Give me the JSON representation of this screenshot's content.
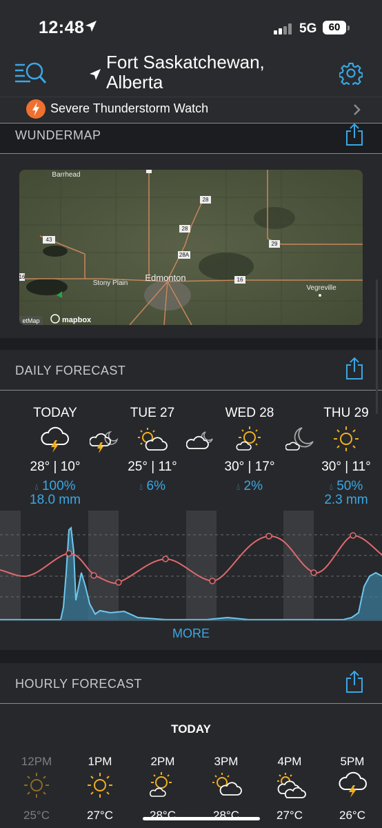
{
  "status_bar": {
    "time": "12:48",
    "network": "5G",
    "battery": "60"
  },
  "header": {
    "location_line1": "Fort Saskatchewan,",
    "location_line2": "Alberta"
  },
  "alert": {
    "text": "Severe Thunderstorm Watch"
  },
  "wundermap": {
    "title": "WUNDERMAP",
    "labels": [
      "Barrhead",
      "Stony Plain",
      "Edmonton",
      "Vegreville"
    ],
    "road_numbers": [
      "43",
      "28",
      "28",
      "28A",
      "29",
      "16",
      "16"
    ],
    "attribution": "mapbox",
    "attribution_left": "etMap"
  },
  "daily": {
    "title": "DAILY FORECAST",
    "days": [
      {
        "name": "TODAY",
        "temps": "28° | 10°",
        "precip": "100%",
        "amount": "18.0 mm",
        "icon": "thunderstorm-icon"
      },
      {
        "name": "TUE 27",
        "temps": "25° | 11°",
        "precip": "6%",
        "amount": "",
        "icon": "partly-sunny-icon"
      },
      {
        "name": "WED 28",
        "temps": "30° | 17°",
        "precip": "2%",
        "amount": "",
        "icon": "mostly-sunny-icon"
      },
      {
        "name": "THU 29",
        "temps": "30° | 11°",
        "precip": "50%",
        "amount": "2.3 mm",
        "icon": "sunny-icon"
      }
    ],
    "night_icons": [
      "night-thunderstorm-icon",
      "night-cloudy-icon",
      "night-partly-cloudy-icon"
    ],
    "more_label": "MORE"
  },
  "hourly": {
    "title": "HOURLY FORECAST",
    "day_label": "TODAY",
    "hours": [
      {
        "time": "12PM",
        "temp": "25°C",
        "icon": "sunny-icon"
      },
      {
        "time": "1PM",
        "temp": "27°C",
        "icon": "sunny-icon"
      },
      {
        "time": "2PM",
        "temp": "28°C",
        "icon": "partly-sunny-icon"
      },
      {
        "time": "3PM",
        "temp": "28°C",
        "icon": "partly-sunny-icon"
      },
      {
        "time": "4PM",
        "temp": "27°C",
        "icon": "partly-cloudy-icon"
      },
      {
        "time": "5PM",
        "temp": "26°C",
        "icon": "thunderstorm-icon"
      }
    ]
  },
  "colors": {
    "accent": "#3aa8e6",
    "temp_line": "#e06a6e",
    "sun": "#f2b01e",
    "alert_orange": "#f07030",
    "background": "#1c1d20"
  }
}
